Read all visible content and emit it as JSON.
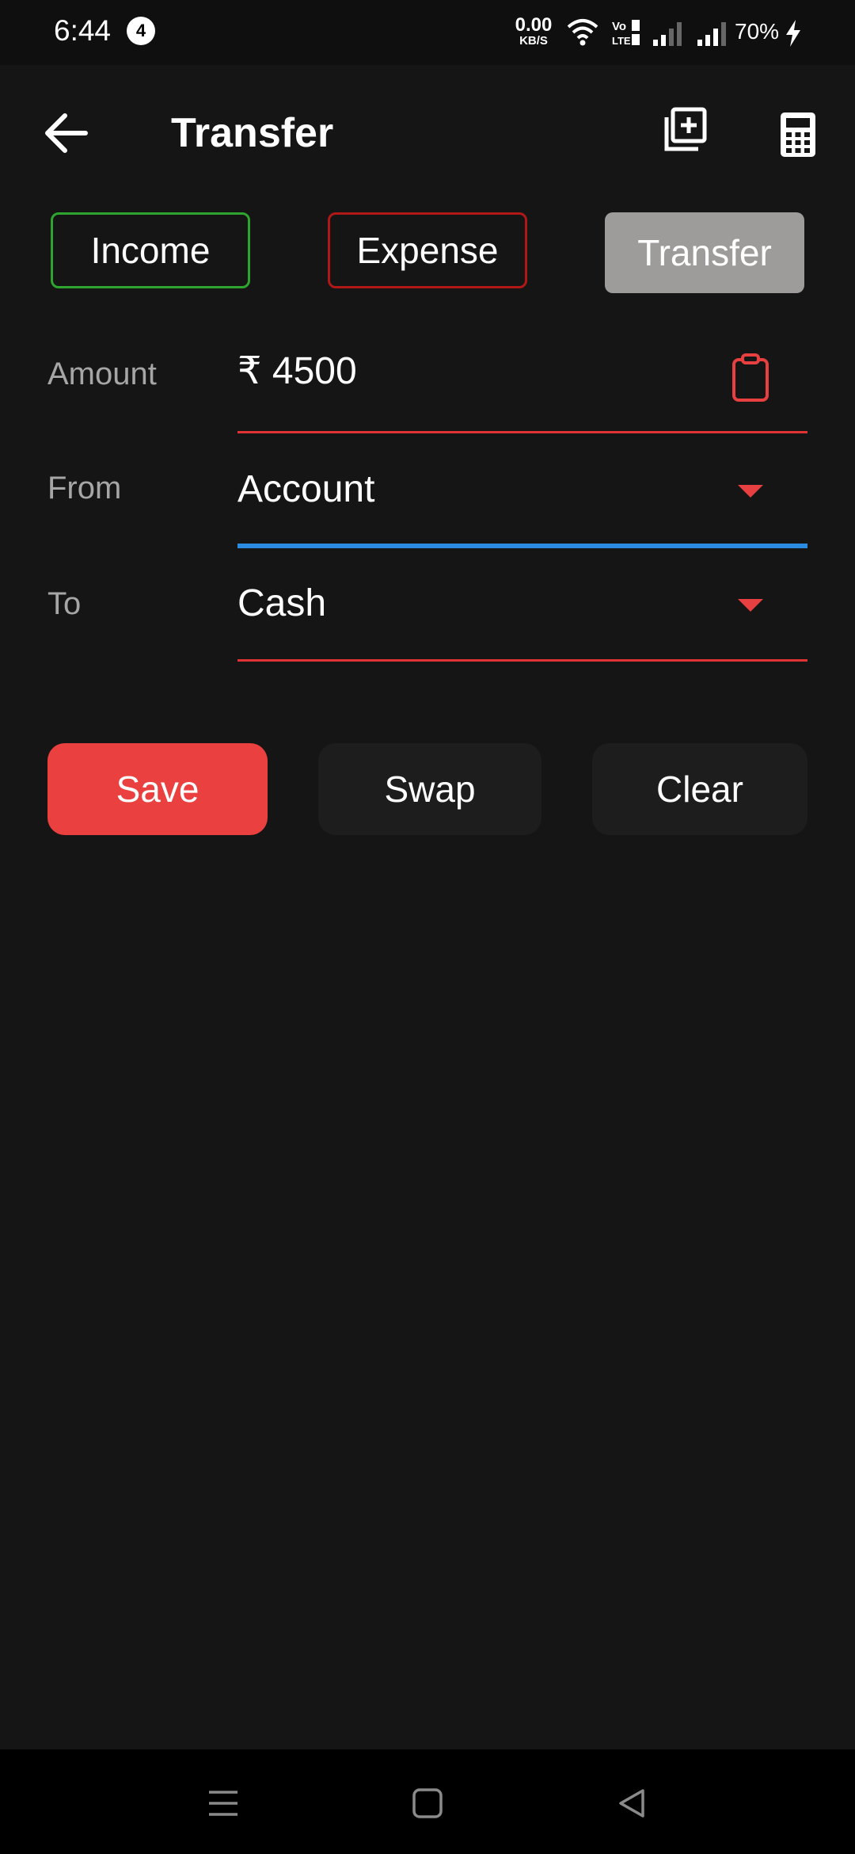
{
  "status_bar": {
    "time": "6:44",
    "notification_count": "4",
    "net_speed_value": "0.00",
    "net_speed_unit": "KB/S",
    "volte_label": "Vo LTE",
    "battery": "70%"
  },
  "header": {
    "title": "Transfer"
  },
  "type_tabs": {
    "income": "Income",
    "expense": "Expense",
    "transfer": "Transfer",
    "selected": "transfer"
  },
  "form": {
    "amount_label": "Amount",
    "amount_value": "₹ 4500",
    "from_label": "From",
    "from_value": "Account",
    "to_label": "To",
    "to_value": "Cash"
  },
  "actions": {
    "save": "Save",
    "swap": "Swap",
    "clear": "Clear"
  },
  "colors": {
    "background": "#151515",
    "accent_red": "#ea4040",
    "income_green": "#2ea52e",
    "expense_red": "#b01818",
    "focus_blue": "#2a8be0",
    "selected_tab": "#9e9b9b"
  },
  "icons": {
    "back": "arrow-left-icon",
    "add_copy": "add-copy-icon",
    "calculator": "calculator-icon",
    "clipboard": "clipboard-icon",
    "dropdown": "caret-down-icon",
    "nav_menu": "menu-icon",
    "nav_home": "home-icon",
    "nav_back": "back-triangle-icon"
  }
}
